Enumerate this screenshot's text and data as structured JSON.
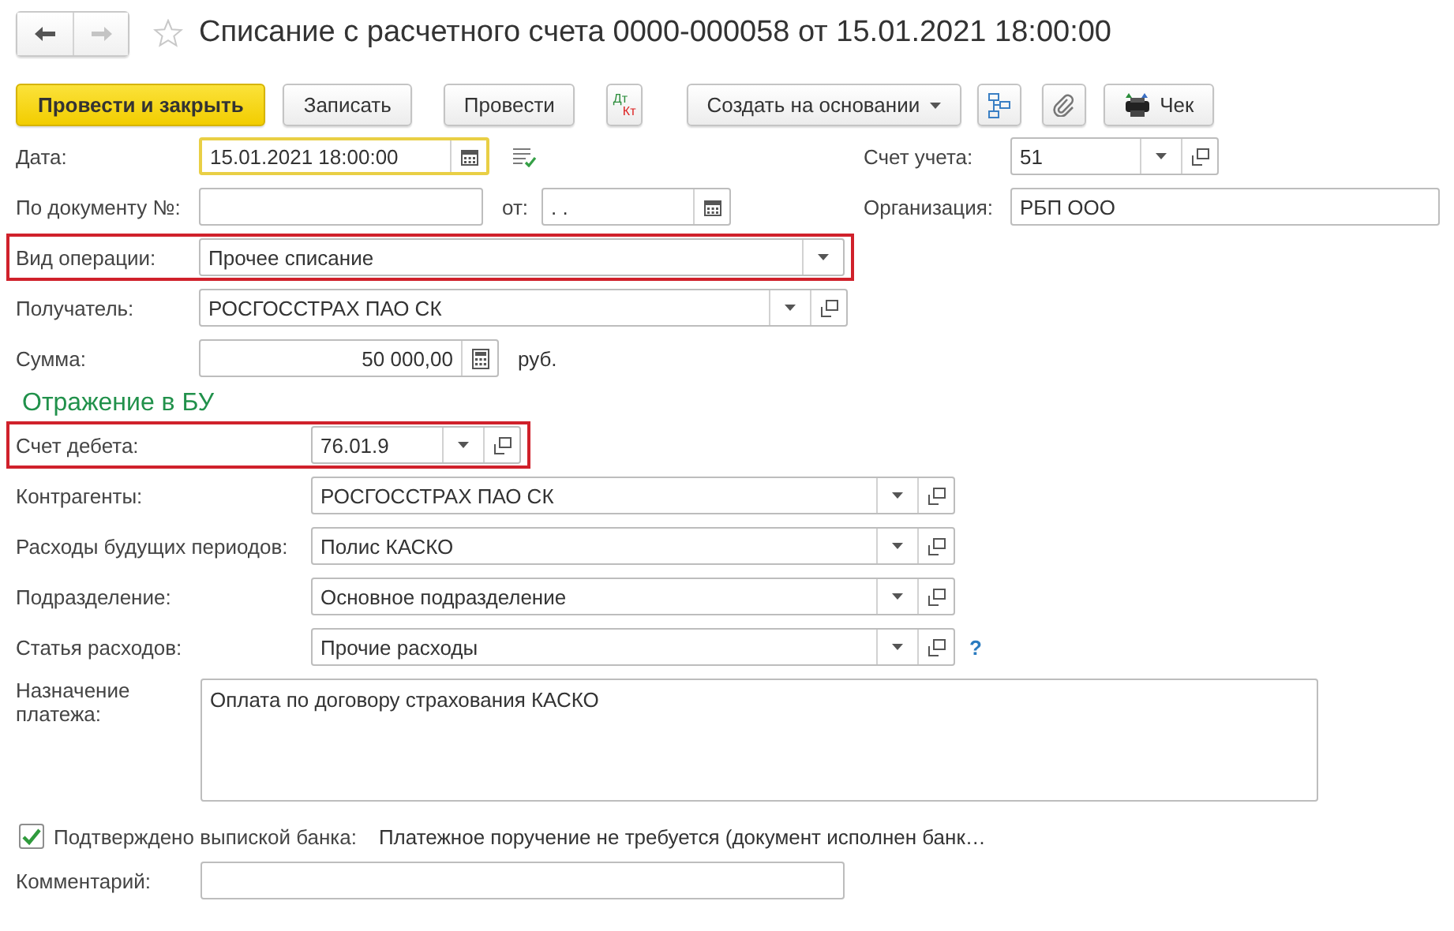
{
  "window": {
    "title": "Списание с расчетного счета 0000-000058 от 15.01.2021 18:00:00",
    "favorite": false
  },
  "toolbar": [
    {
      "kind": "primary",
      "label": "Провести и закрыть"
    },
    {
      "kind": "text",
      "label": "Записать"
    },
    {
      "kind": "text",
      "label": "Провести"
    },
    {
      "kind": "dtkt",
      "debit": "Дт",
      "credit": "Кт"
    },
    {
      "kind": "dropdown",
      "label": "Создать на основании"
    },
    {
      "kind": "structure"
    },
    {
      "kind": "attach"
    },
    {
      "kind": "receipt",
      "label": "Чек"
    }
  ],
  "header_fields": [
    {
      "kind": "date",
      "label": "Дата:",
      "value": "15.01.2021 18:00:00",
      "focused": true,
      "highlighted": false
    },
    {
      "kind": "combo",
      "label": "Счет учета:",
      "value": "51",
      "focused": false,
      "highlighted": false
    },
    {
      "kind": "text",
      "label": "По документу №:",
      "focused": false,
      "highlighted": false
    },
    {
      "kind": "date",
      "label": "от:",
      "value": ". .",
      "focused": false,
      "highlighted": false
    },
    {
      "kind": "text",
      "label": "Организация:",
      "value": "РБП ООО",
      "focused": false,
      "highlighted": false
    },
    {
      "kind": "select",
      "label": "Вид операции:",
      "value": "Прочее списание",
      "focused": false,
      "highlighted": true
    },
    {
      "kind": "combo",
      "label": "Получатель:",
      "value": "РОСГОССТРАХ ПАО СК",
      "focused": false,
      "highlighted": false
    },
    {
      "kind": "number",
      "label": "Сумма:",
      "value": "50 000,00",
      "unit": "руб.",
      "focused": false,
      "highlighted": false
    }
  ],
  "accounting": {
    "heading": "Отражение в БУ",
    "fields": [
      {
        "kind": "combo",
        "label": "Счет дебета:",
        "value": "76.01.9",
        "focused": false,
        "highlighted": true
      },
      {
        "kind": "combo",
        "label": "Контрагенты:",
        "value": "РОСГОССТРАХ ПАО СК",
        "focused": false,
        "highlighted": false
      },
      {
        "kind": "combo",
        "label": "Расходы будущих периодов:",
        "value": "Полис КАСКО",
        "focused": false,
        "highlighted": false
      },
      {
        "kind": "combo",
        "label": "Подразделение:",
        "value": "Основное подразделение",
        "focused": false,
        "highlighted": false
      },
      {
        "kind": "combo",
        "label": "Статья расходов:",
        "value": "Прочие расходы",
        "help": "?",
        "focused": false,
        "highlighted": false
      }
    ]
  },
  "purpose": {
    "kind": "textarea",
    "label": "Назначение платежа:",
    "value": "Оплата по договору страхования КАСКО"
  },
  "bank_confirmation": {
    "label": "Подтверждено выпиской банка:",
    "checked": true,
    "note": "Платежное поручение не требуется (документ исполнен банк…"
  },
  "comment": {
    "kind": "text",
    "label": "Комментарий:"
  }
}
